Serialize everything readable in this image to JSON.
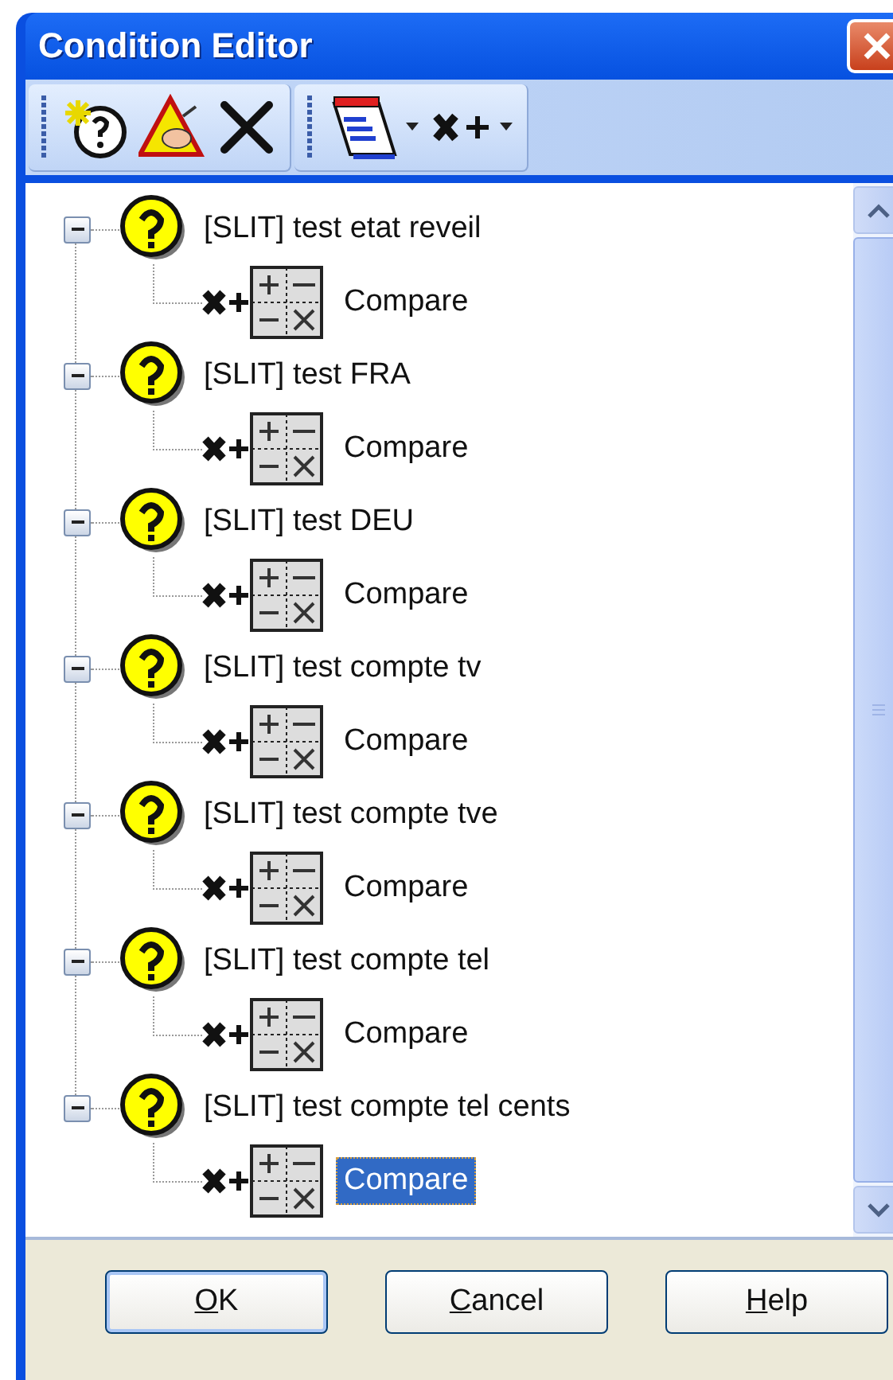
{
  "window": {
    "title": "Condition Editor"
  },
  "toolbar": {
    "groups": [
      {
        "buttons": [
          {
            "kind": "new-condition",
            "dropdown": false
          },
          {
            "kind": "warning",
            "dropdown": false
          },
          {
            "kind": "delete",
            "dropdown": false
          }
        ]
      },
      {
        "buttons": [
          {
            "kind": "calendar",
            "dropdown": true
          },
          {
            "kind": "variable-add",
            "dropdown": true
          }
        ]
      }
    ]
  },
  "tree": {
    "items": [
      {
        "label": "[SLIT] test etat reveil",
        "expanded": true,
        "children": [
          {
            "label": "Compare",
            "selected": false
          }
        ]
      },
      {
        "label": "[SLIT] test FRA",
        "expanded": true,
        "children": [
          {
            "label": "Compare",
            "selected": false
          }
        ]
      },
      {
        "label": "[SLIT] test DEU",
        "expanded": true,
        "children": [
          {
            "label": "Compare",
            "selected": false
          }
        ]
      },
      {
        "label": "[SLIT] test compte tv",
        "expanded": true,
        "children": [
          {
            "label": "Compare",
            "selected": false
          }
        ]
      },
      {
        "label": "[SLIT] test compte tve",
        "expanded": true,
        "children": [
          {
            "label": "Compare",
            "selected": false
          }
        ]
      },
      {
        "label": "[SLIT] test compte tel",
        "expanded": true,
        "children": [
          {
            "label": "Compare",
            "selected": false
          }
        ]
      },
      {
        "label": "[SLIT] test compte tel cents",
        "expanded": true,
        "children": [
          {
            "label": "Compare",
            "selected": true
          }
        ]
      }
    ]
  },
  "buttons": [
    {
      "access_key": "O",
      "rest": "K",
      "default": true
    },
    {
      "access_key": "C",
      "rest": "ancel",
      "default": false
    },
    {
      "access_key": "H",
      "rest": "elp",
      "default": false
    }
  ]
}
